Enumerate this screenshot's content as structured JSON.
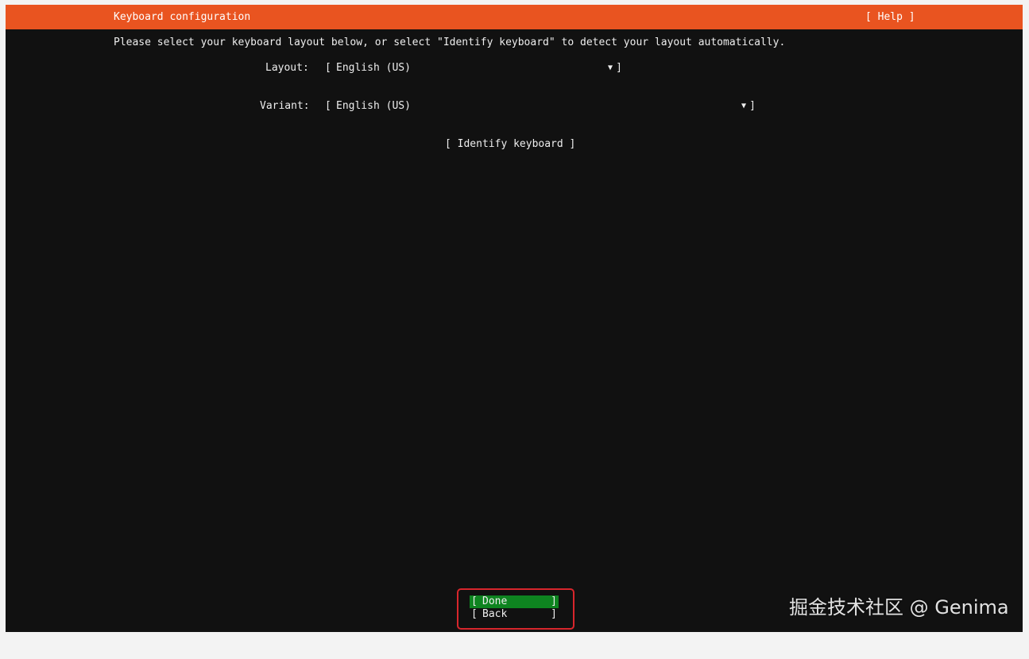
{
  "header": {
    "title": "Keyboard configuration",
    "help_label": "[ Help ]",
    "color": "#e95420"
  },
  "instruction": "Please select your keyboard layout below, or select \"Identify keyboard\" to detect your layout automatically.",
  "layout": {
    "label": "Layout:",
    "bracket_open": "[",
    "value": "English (US)",
    "arrow": "▼",
    "bracket_close": "]"
  },
  "variant": {
    "label": "Variant:",
    "bracket_open": "[",
    "value": "English (US)",
    "arrow": "▼",
    "bracket_close": "]"
  },
  "identify_button_label": "[ Identify keyboard ]",
  "actions": {
    "done": {
      "open": "[",
      "label": "Done",
      "close": "]",
      "color": "#0e8420"
    },
    "back": {
      "open": "[",
      "label": "Back",
      "close": "]"
    }
  },
  "watermark": "掘金技术社区 @ Genima"
}
